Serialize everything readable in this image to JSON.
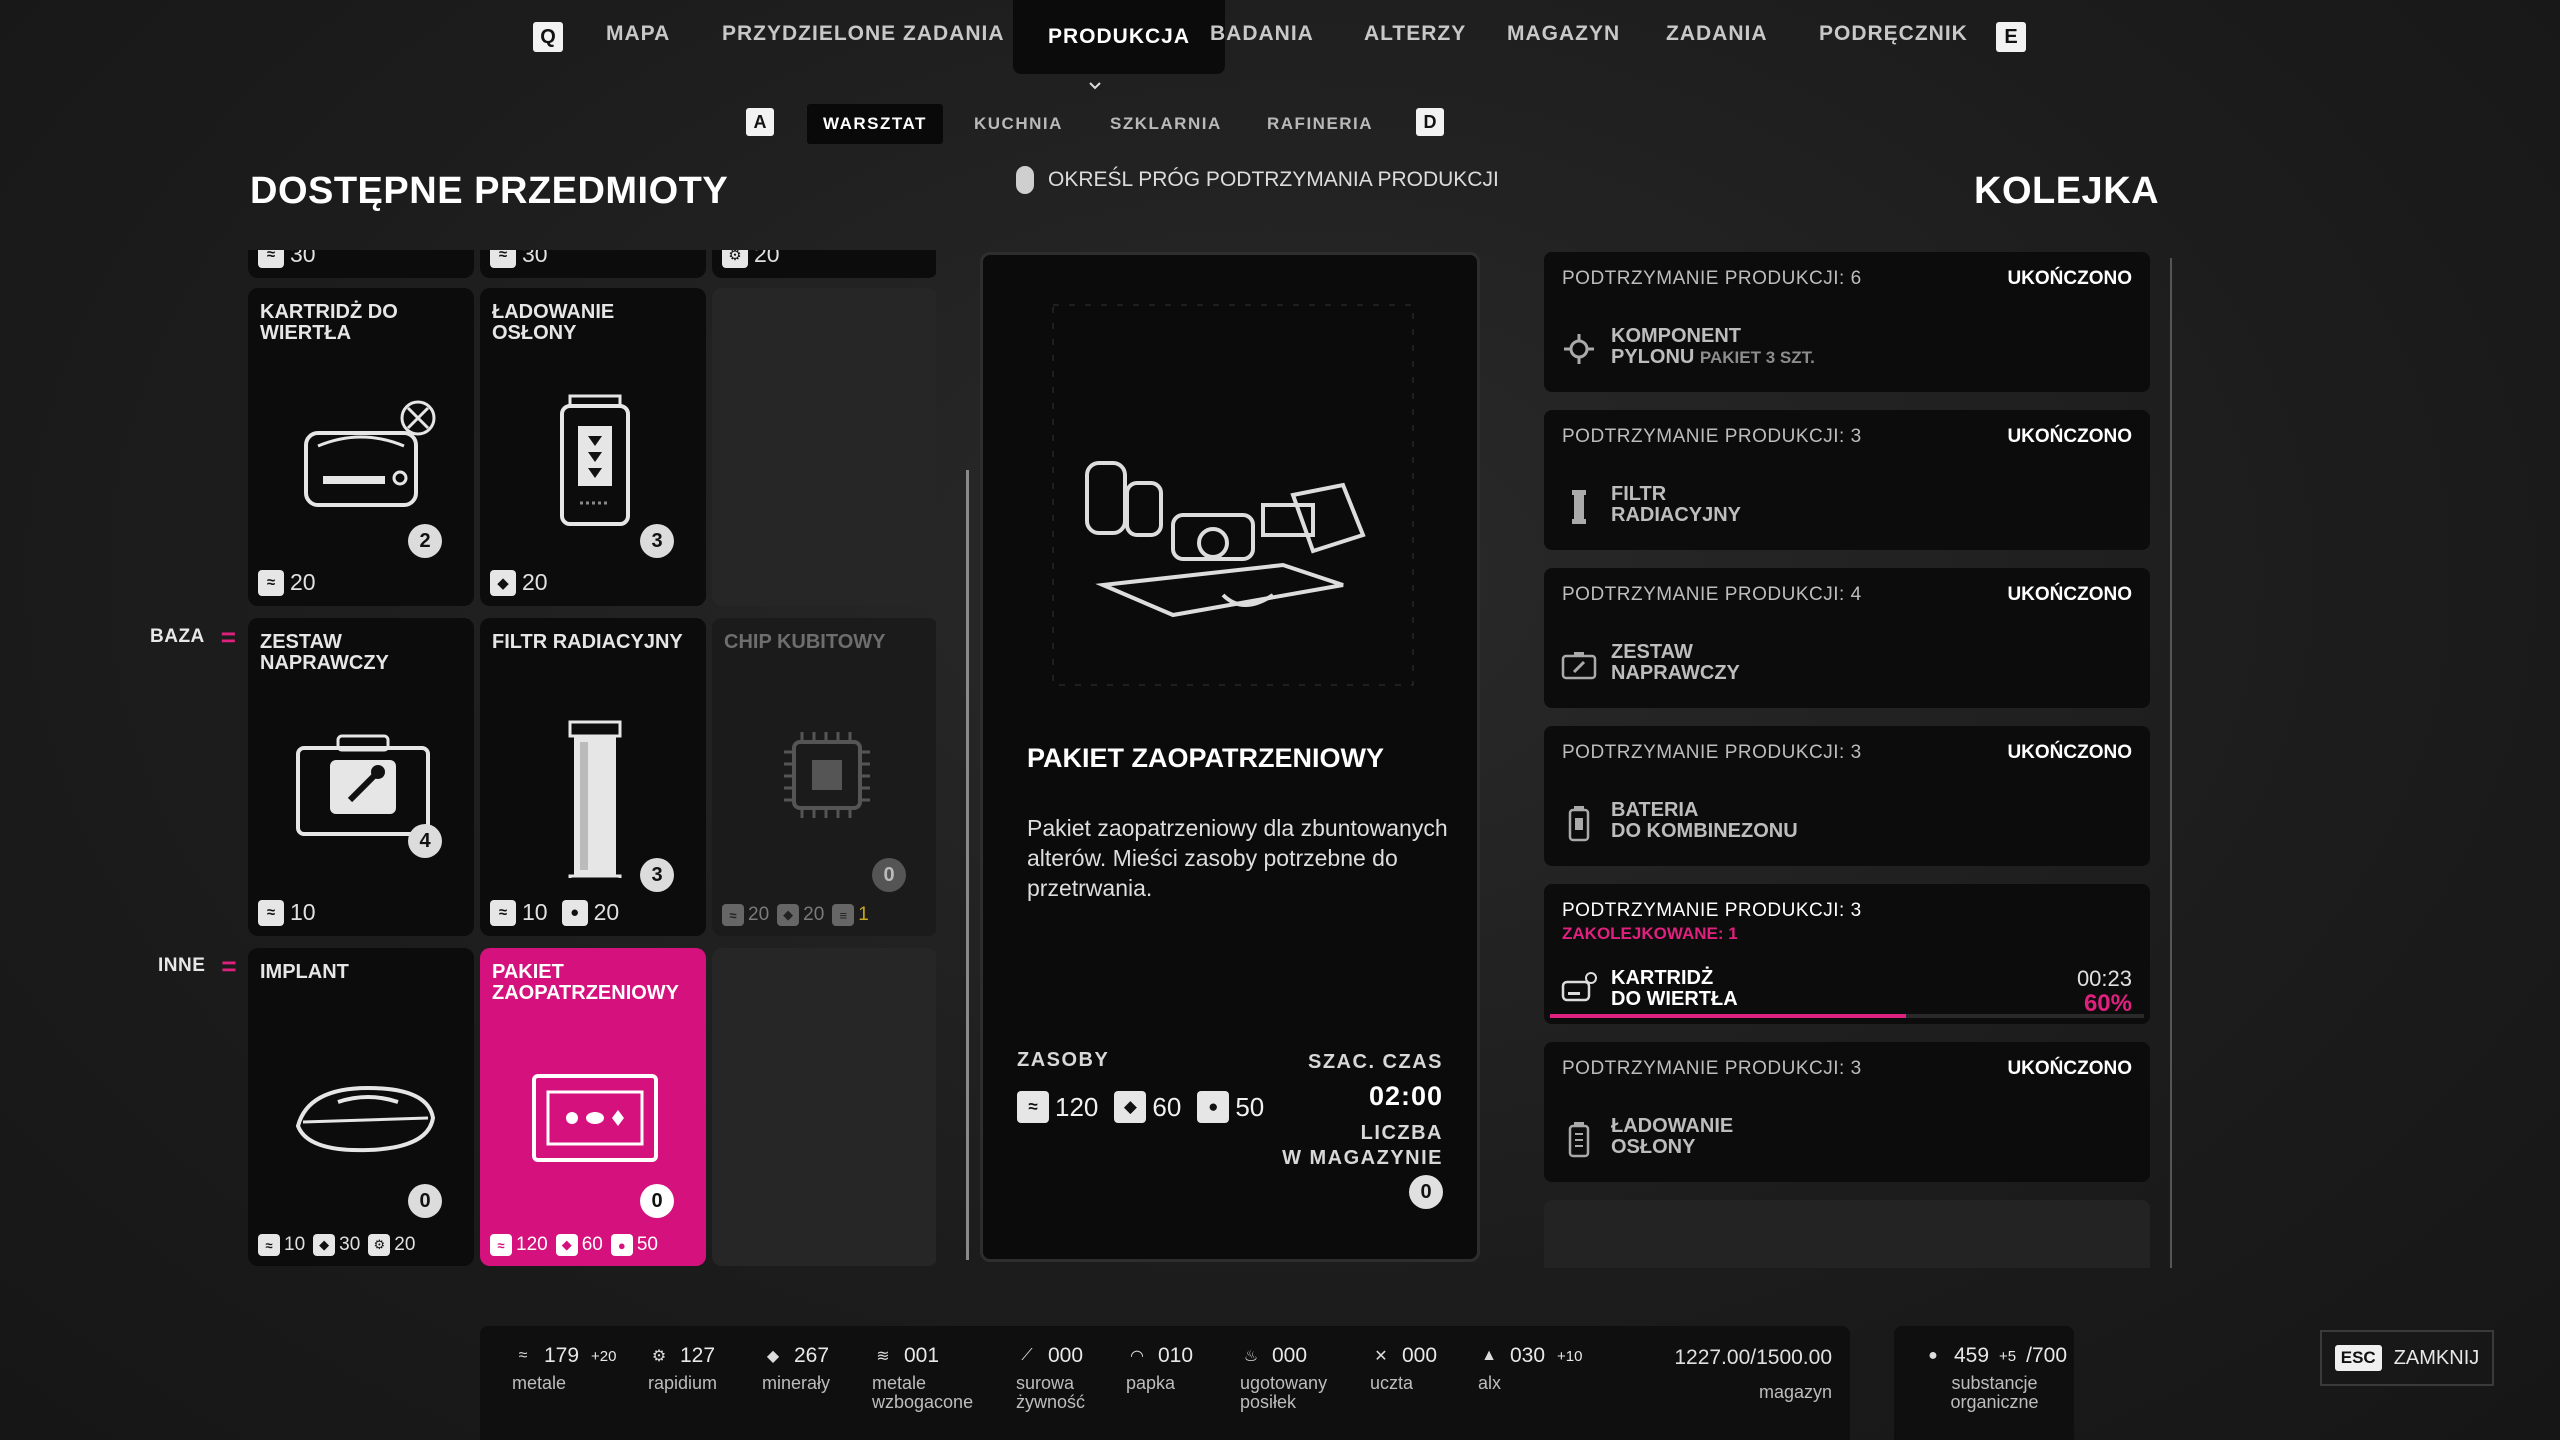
{
  "nav": {
    "key_left": "Q",
    "key_right": "E",
    "tabs": [
      "MAPA",
      "PRZYDZIELONE ZADANIA",
      "PRODUKCJA",
      "BADANIA",
      "ALTERZY",
      "MAGAZYN",
      "ZADANIA",
      "PODRĘCZNIK"
    ],
    "active_tab": "PRODUKCJA"
  },
  "subnav": {
    "key_left": "A",
    "key_right": "D",
    "tabs": [
      "WARSZTAT",
      "KUCHNIA",
      "SZKLARNIA",
      "RAFINERIA"
    ],
    "active_tab": "WARSZTAT"
  },
  "left_title": "DOSTĘPNE PRZEDMIOTY",
  "right_title": "KOLEJKA",
  "hint": "OKREŚL PRÓG PODTRZYMANIA PRODUKCJI",
  "categories": {
    "base": "BAZA",
    "other": "INNE"
  },
  "top_partial": {
    "c1": "30",
    "c2": "30",
    "c3": "20"
  },
  "items": {
    "drill": {
      "name": "KARTRIDŻ DO WIERTŁA",
      "count": "2",
      "cost1": "20"
    },
    "shield": {
      "name": "ŁADOWANIE OSŁONY",
      "count": "3",
      "cost1": "20"
    },
    "repair": {
      "name": "ZESTAW NAPRAWCZY",
      "count": "4",
      "cost1": "10"
    },
    "filter": {
      "name": "FILTR RADIACYJNY",
      "count": "3",
      "cost1": "10",
      "cost2": "20"
    },
    "chip": {
      "name": "CHIP KUBITOWY",
      "count": "0",
      "cost1": "20",
      "cost2": "20",
      "cost3": "1"
    },
    "implant": {
      "name": "IMPLANT",
      "count": "0",
      "cost1": "10",
      "cost2": "30",
      "cost3": "20"
    },
    "supply": {
      "name": "PAKIET ZAOPATRZENIOWY",
      "count": "0",
      "cost1": "120",
      "cost2": "60",
      "cost3": "50"
    }
  },
  "detail": {
    "name": "PAKIET ZAOPATRZENIOWY",
    "description": "Pakiet zaopatrzeniowy dla zbuntowanych alterów. Mieści zasoby potrzebne do przetrwania.",
    "resources_label": "ZASOBY",
    "res1": "120",
    "res2": "60",
    "res3": "50",
    "time_label": "SZAC. CZAS",
    "time": "02:00",
    "stock_label": "LICZBA\nW MAGAZYNIE",
    "stock": "0"
  },
  "queue": [
    {
      "head": "PODTRZYMANIE PRODUKCJI: 6",
      "status": "UKOŃCZONO",
      "name": "KOMPONENT",
      "name2": "PYLONU",
      "sub": "PAKIET 3 SZT.",
      "icon": "pylon-icon"
    },
    {
      "head": "PODTRZYMANIE PRODUKCJI: 3",
      "status": "UKOŃCZONO",
      "name": "FILTR",
      "name2": "RADIACYJNY",
      "icon": "filter-icon"
    },
    {
      "head": "PODTRZYMANIE PRODUKCJI: 4",
      "status": "UKOŃCZONO",
      "name": "ZESTAW",
      "name2": "NAPRAWCZY",
      "icon": "repair-kit-icon"
    },
    {
      "head": "PODTRZYMANIE PRODUKCJI: 3",
      "status": "UKOŃCZONO",
      "name": "BATERIA",
      "name2": "DO KOMBINEZONU",
      "icon": "battery-icon"
    },
    {
      "head": "PODTRZYMANIE PRODUKCJI: 3",
      "queued": "ZAKOLEJKOWANE: 1",
      "name": "KARTRIDŻ",
      "name2": "DO WIERTŁA",
      "time": "00:23",
      "percent": "60%",
      "progress": 0.6,
      "icon": "drill-icon"
    },
    {
      "head": "PODTRZYMANIE PRODUKCJI: 3",
      "status": "UKOŃCZONO",
      "name": "ŁADOWANIE",
      "name2": "OSŁONY",
      "icon": "shield-charge-icon"
    }
  ],
  "resources": [
    {
      "value": "179",
      "sup": "+20",
      "label": "metale",
      "icon": "metals-icon"
    },
    {
      "value": "127",
      "sup": "",
      "label": "rapidium",
      "icon": "rapidium-icon"
    },
    {
      "value": "267",
      "sup": "",
      "label": "minerały",
      "icon": "minerals-icon"
    },
    {
      "value": "001",
      "sup": "",
      "label": "metale\nwzbogacone",
      "icon": "enriched-metals-icon"
    },
    {
      "value": "000",
      "sup": "",
      "label": "surowa\nżywność",
      "icon": "raw-food-icon"
    },
    {
      "value": "010",
      "sup": "",
      "label": "papka",
      "icon": "mush-icon"
    },
    {
      "value": "000",
      "sup": "",
      "label": "ugotowany\nposiłek",
      "icon": "cooked-meal-icon"
    },
    {
      "value": "000",
      "sup": "",
      "label": "uczta",
      "icon": "feast-icon"
    },
    {
      "value": "030",
      "sup": "+10",
      "label": "alx",
      "icon": "alx-icon"
    }
  ],
  "storage": {
    "value": "1227.00/1500.00",
    "label": "magazyn"
  },
  "organic": {
    "value": "459",
    "sup": "+5",
    "max": "/700",
    "label": "substancje\norganiczne"
  },
  "close": {
    "key": "ESC",
    "label": "ZAMKNIJ"
  },
  "colors": {
    "accent": "#d4117c",
    "card": "#0c0c0c",
    "background": "#1e1e1e"
  }
}
